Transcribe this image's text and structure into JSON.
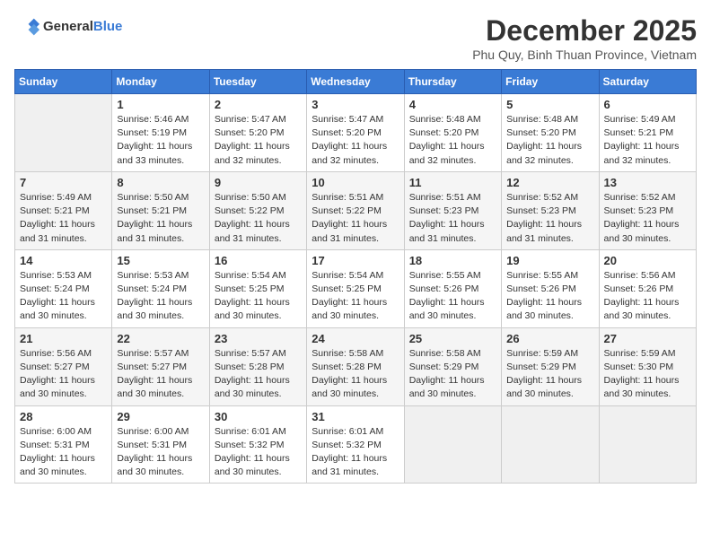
{
  "logo": {
    "general": "General",
    "blue": "Blue"
  },
  "title": "December 2025",
  "subtitle": "Phu Quy, Binh Thuan Province, Vietnam",
  "headers": [
    "Sunday",
    "Monday",
    "Tuesday",
    "Wednesday",
    "Thursday",
    "Friday",
    "Saturday"
  ],
  "weeks": [
    [
      {
        "num": "",
        "info": ""
      },
      {
        "num": "1",
        "info": "Sunrise: 5:46 AM\nSunset: 5:19 PM\nDaylight: 11 hours\nand 33 minutes."
      },
      {
        "num": "2",
        "info": "Sunrise: 5:47 AM\nSunset: 5:20 PM\nDaylight: 11 hours\nand 32 minutes."
      },
      {
        "num": "3",
        "info": "Sunrise: 5:47 AM\nSunset: 5:20 PM\nDaylight: 11 hours\nand 32 minutes."
      },
      {
        "num": "4",
        "info": "Sunrise: 5:48 AM\nSunset: 5:20 PM\nDaylight: 11 hours\nand 32 minutes."
      },
      {
        "num": "5",
        "info": "Sunrise: 5:48 AM\nSunset: 5:20 PM\nDaylight: 11 hours\nand 32 minutes."
      },
      {
        "num": "6",
        "info": "Sunrise: 5:49 AM\nSunset: 5:21 PM\nDaylight: 11 hours\nand 32 minutes."
      }
    ],
    [
      {
        "num": "7",
        "info": "Sunrise: 5:49 AM\nSunset: 5:21 PM\nDaylight: 11 hours\nand 31 minutes."
      },
      {
        "num": "8",
        "info": "Sunrise: 5:50 AM\nSunset: 5:21 PM\nDaylight: 11 hours\nand 31 minutes."
      },
      {
        "num": "9",
        "info": "Sunrise: 5:50 AM\nSunset: 5:22 PM\nDaylight: 11 hours\nand 31 minutes."
      },
      {
        "num": "10",
        "info": "Sunrise: 5:51 AM\nSunset: 5:22 PM\nDaylight: 11 hours\nand 31 minutes."
      },
      {
        "num": "11",
        "info": "Sunrise: 5:51 AM\nSunset: 5:23 PM\nDaylight: 11 hours\nand 31 minutes."
      },
      {
        "num": "12",
        "info": "Sunrise: 5:52 AM\nSunset: 5:23 PM\nDaylight: 11 hours\nand 31 minutes."
      },
      {
        "num": "13",
        "info": "Sunrise: 5:52 AM\nSunset: 5:23 PM\nDaylight: 11 hours\nand 30 minutes."
      }
    ],
    [
      {
        "num": "14",
        "info": "Sunrise: 5:53 AM\nSunset: 5:24 PM\nDaylight: 11 hours\nand 30 minutes."
      },
      {
        "num": "15",
        "info": "Sunrise: 5:53 AM\nSunset: 5:24 PM\nDaylight: 11 hours\nand 30 minutes."
      },
      {
        "num": "16",
        "info": "Sunrise: 5:54 AM\nSunset: 5:25 PM\nDaylight: 11 hours\nand 30 minutes."
      },
      {
        "num": "17",
        "info": "Sunrise: 5:54 AM\nSunset: 5:25 PM\nDaylight: 11 hours\nand 30 minutes."
      },
      {
        "num": "18",
        "info": "Sunrise: 5:55 AM\nSunset: 5:26 PM\nDaylight: 11 hours\nand 30 minutes."
      },
      {
        "num": "19",
        "info": "Sunrise: 5:55 AM\nSunset: 5:26 PM\nDaylight: 11 hours\nand 30 minutes."
      },
      {
        "num": "20",
        "info": "Sunrise: 5:56 AM\nSunset: 5:26 PM\nDaylight: 11 hours\nand 30 minutes."
      }
    ],
    [
      {
        "num": "21",
        "info": "Sunrise: 5:56 AM\nSunset: 5:27 PM\nDaylight: 11 hours\nand 30 minutes."
      },
      {
        "num": "22",
        "info": "Sunrise: 5:57 AM\nSunset: 5:27 PM\nDaylight: 11 hours\nand 30 minutes."
      },
      {
        "num": "23",
        "info": "Sunrise: 5:57 AM\nSunset: 5:28 PM\nDaylight: 11 hours\nand 30 minutes."
      },
      {
        "num": "24",
        "info": "Sunrise: 5:58 AM\nSunset: 5:28 PM\nDaylight: 11 hours\nand 30 minutes."
      },
      {
        "num": "25",
        "info": "Sunrise: 5:58 AM\nSunset: 5:29 PM\nDaylight: 11 hours\nand 30 minutes."
      },
      {
        "num": "26",
        "info": "Sunrise: 5:59 AM\nSunset: 5:29 PM\nDaylight: 11 hours\nand 30 minutes."
      },
      {
        "num": "27",
        "info": "Sunrise: 5:59 AM\nSunset: 5:30 PM\nDaylight: 11 hours\nand 30 minutes."
      }
    ],
    [
      {
        "num": "28",
        "info": "Sunrise: 6:00 AM\nSunset: 5:31 PM\nDaylight: 11 hours\nand 30 minutes."
      },
      {
        "num": "29",
        "info": "Sunrise: 6:00 AM\nSunset: 5:31 PM\nDaylight: 11 hours\nand 30 minutes."
      },
      {
        "num": "30",
        "info": "Sunrise: 6:01 AM\nSunset: 5:32 PM\nDaylight: 11 hours\nand 30 minutes."
      },
      {
        "num": "31",
        "info": "Sunrise: 6:01 AM\nSunset: 5:32 PM\nDaylight: 11 hours\nand 31 minutes."
      },
      {
        "num": "",
        "info": ""
      },
      {
        "num": "",
        "info": ""
      },
      {
        "num": "",
        "info": ""
      }
    ]
  ]
}
